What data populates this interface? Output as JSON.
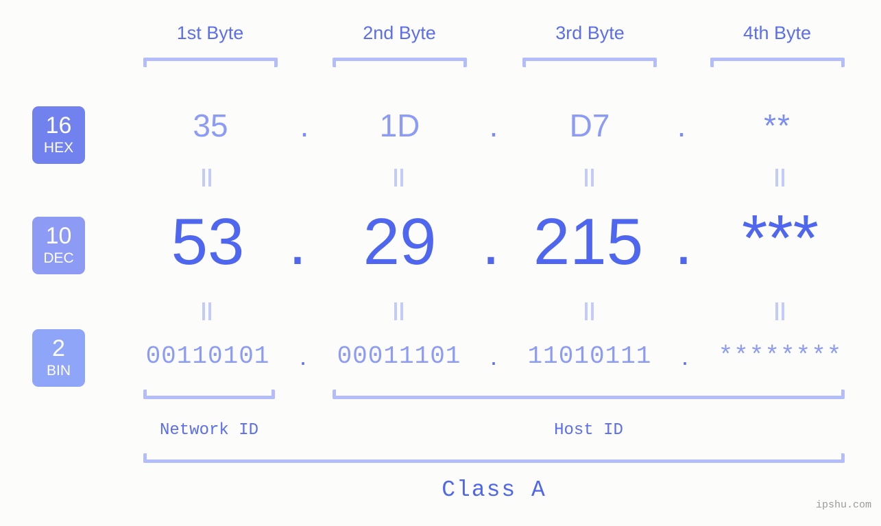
{
  "background_color": "#fcfdfa",
  "accent_colors": {
    "strong_blue": "#4f66ee",
    "mid_blue": "#5b6ef0",
    "light_blue": "#8b9bf6",
    "pale_blue": "#b3bdfb",
    "eq_mark": "#c3cbfb",
    "badge_hex": "#7182ef",
    "badge_dec": "#8d9bf4",
    "badge_bin": "#8fa5f8"
  },
  "byte_headers": [
    {
      "label": "1st Byte"
    },
    {
      "label": "2nd Byte"
    },
    {
      "label": "3rd Byte"
    },
    {
      "label": "4th Byte"
    }
  ],
  "bases": [
    {
      "number": "16",
      "name": "HEX"
    },
    {
      "number": "10",
      "name": "DEC"
    },
    {
      "number": "2",
      "name": "BIN"
    }
  ],
  "rows": {
    "hex": {
      "values": [
        "35",
        "1D",
        "D7",
        "**"
      ],
      "separator": "."
    },
    "dec": {
      "values": [
        "53",
        "29",
        "215",
        "***"
      ],
      "separator": "."
    },
    "bin": {
      "values": [
        "00110101",
        "00011101",
        "11010111",
        "********"
      ],
      "separator": "."
    }
  },
  "equality_mark": "||",
  "segments": {
    "network_id": "Network ID",
    "host_id": "Host ID",
    "class": "Class A"
  },
  "watermark": "ipshu.com"
}
